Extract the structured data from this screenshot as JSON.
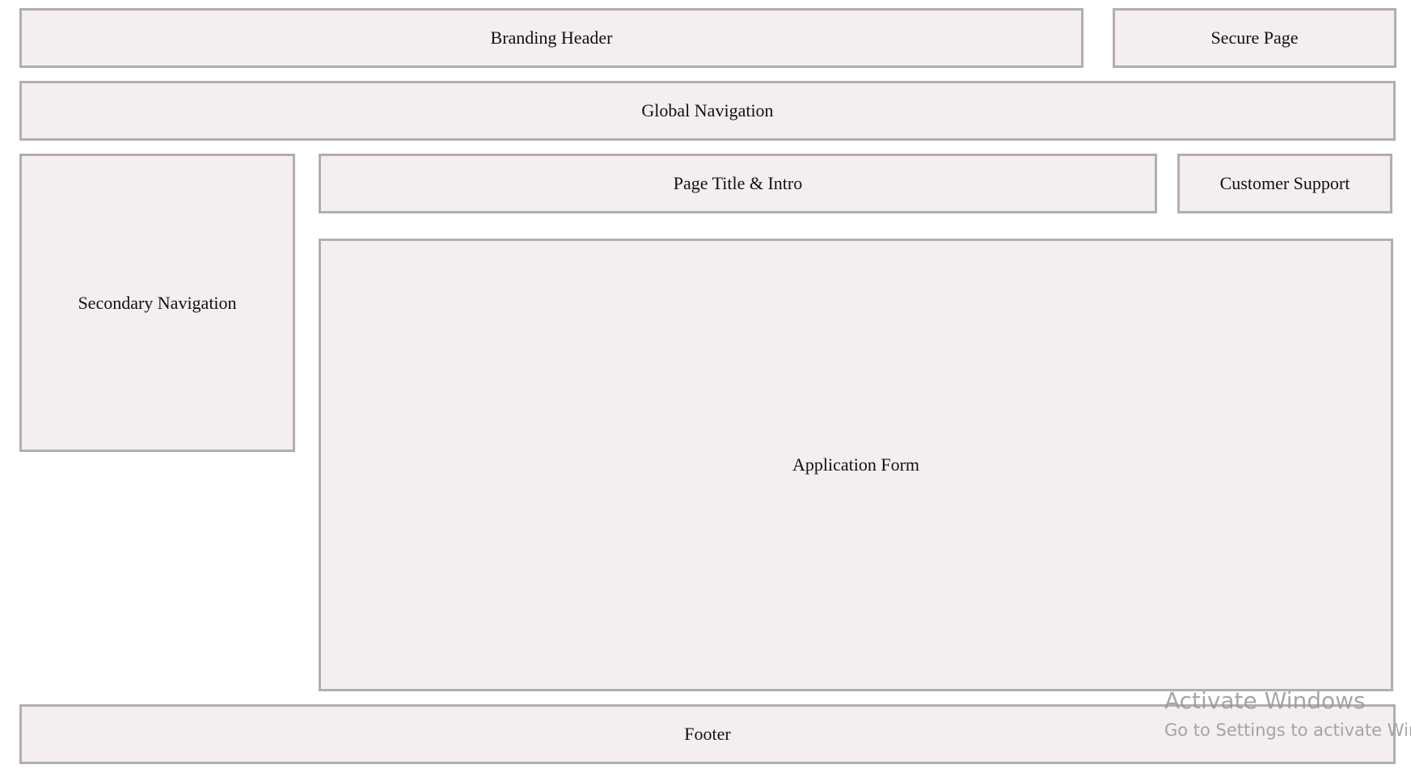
{
  "regions": {
    "branding_header": "Branding Header",
    "secure_page": "Secure Page",
    "global_navigation": "Global Navigation",
    "secondary_navigation": "Secondary Navigation",
    "page_title_intro": "Page Title & Intro",
    "customer_support": "Customer Support",
    "application_form": "Application Form",
    "footer": "Footer"
  },
  "watermark": {
    "title": "Activate Windows",
    "subtitle": "Go to Settings to activate Windows."
  },
  "colors": {
    "box_fill": "#f4eeee",
    "box_border": "#b2aeae",
    "text": "#111111"
  }
}
